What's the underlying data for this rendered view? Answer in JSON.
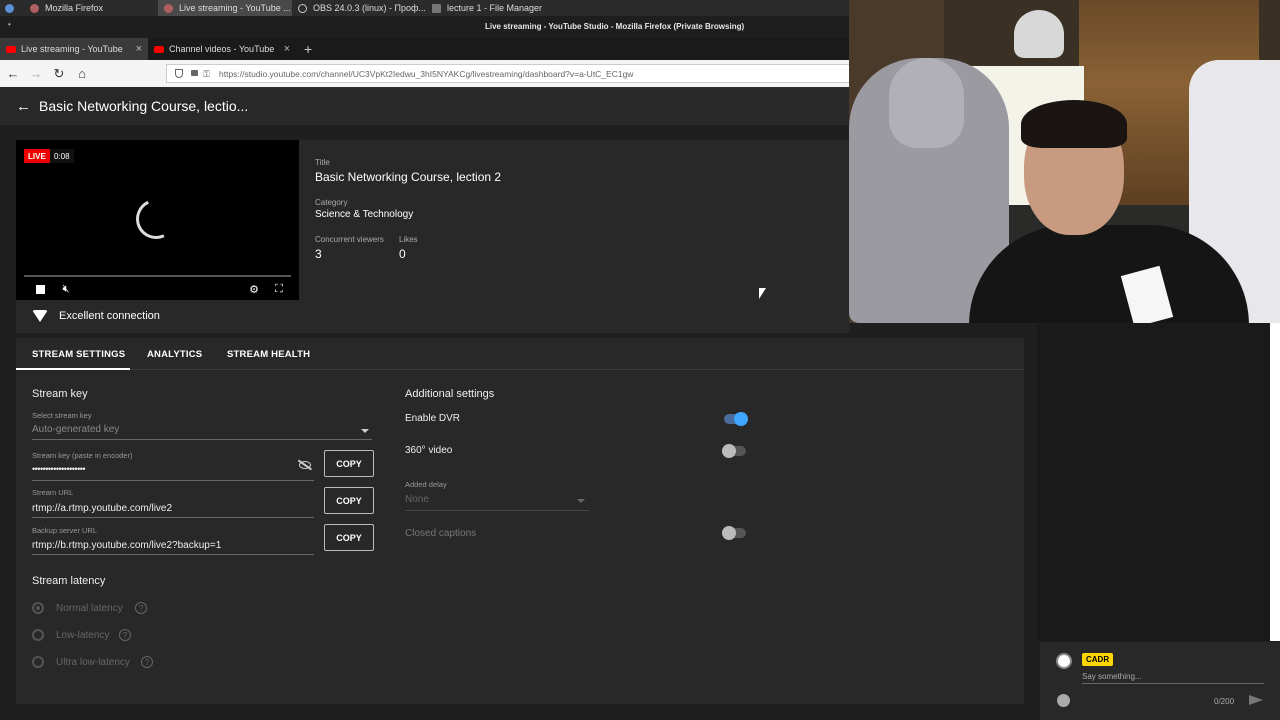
{
  "taskbar": {
    "tasks": [
      {
        "label": "Mozilla Firefox"
      },
      {
        "label": "Live streaming - YouTube ..."
      },
      {
        "label": "OBS 24.0.3 (linux) - Проф..."
      },
      {
        "label": "lecture 1 - File Manager"
      }
    ]
  },
  "window": {
    "title": "Live streaming - YouTube Studio - Mozilla Firefox (Private Browsing)"
  },
  "browser": {
    "tabs": [
      {
        "label": "Live streaming - YouTube"
      },
      {
        "label": "Channel videos - YouTube"
      }
    ],
    "url": "https://studio.youtube.com/channel/UC3VpKt2Iedwu_3hI5NYAKCg/livestreaming/dashboard?v=a-UtC_EC1gw"
  },
  "studio": {
    "header_title": "Basic Networking Course, lectio..."
  },
  "video": {
    "live_label": "LIVE",
    "time": "0:08"
  },
  "meta": {
    "title_label": "Title",
    "title_value": "Basic Networking Course, lection 2",
    "category_label": "Category",
    "category_value": "Science & Technology",
    "viewers_label": "Concurrent viewers",
    "viewers_value": "3",
    "likes_label": "Likes",
    "likes_value": "0"
  },
  "connection": {
    "status": "Excellent connection"
  },
  "settings_tabs": [
    {
      "label": "STREAM SETTINGS"
    },
    {
      "label": "ANALYTICS"
    },
    {
      "label": "STREAM HEALTH"
    }
  ],
  "stream_key": {
    "heading": "Stream key",
    "select_label": "Select stream key",
    "select_value": "Auto-generated key",
    "key_label": "Stream key (paste in encoder)",
    "key_value": "••••••••••••••••••••",
    "url_label": "Stream URL",
    "url_value": "rtmp://a.rtmp.youtube.com/live2",
    "backup_label": "Backup server URL",
    "backup_value": "rtmp://b.rtmp.youtube.com/live2?backup=1",
    "copy_label": "COPY"
  },
  "latency": {
    "heading": "Stream latency",
    "options": [
      {
        "label": "Normal latency",
        "selected": true
      },
      {
        "label": "Low-latency",
        "selected": false
      },
      {
        "label": "Ultra low-latency",
        "selected": false
      }
    ],
    "help_glyph": "?"
  },
  "additional": {
    "heading": "Additional settings",
    "dvr_label": "Enable DVR",
    "dvr_on": true,
    "video360_label": "360° video",
    "video360_on": false,
    "delay_label": "Added delay",
    "delay_value": "None",
    "captions_label": "Closed captions",
    "captions_on": false
  },
  "chat": {
    "user_badge": "CADR",
    "placeholder": "Say something...",
    "counter": "0/200"
  }
}
